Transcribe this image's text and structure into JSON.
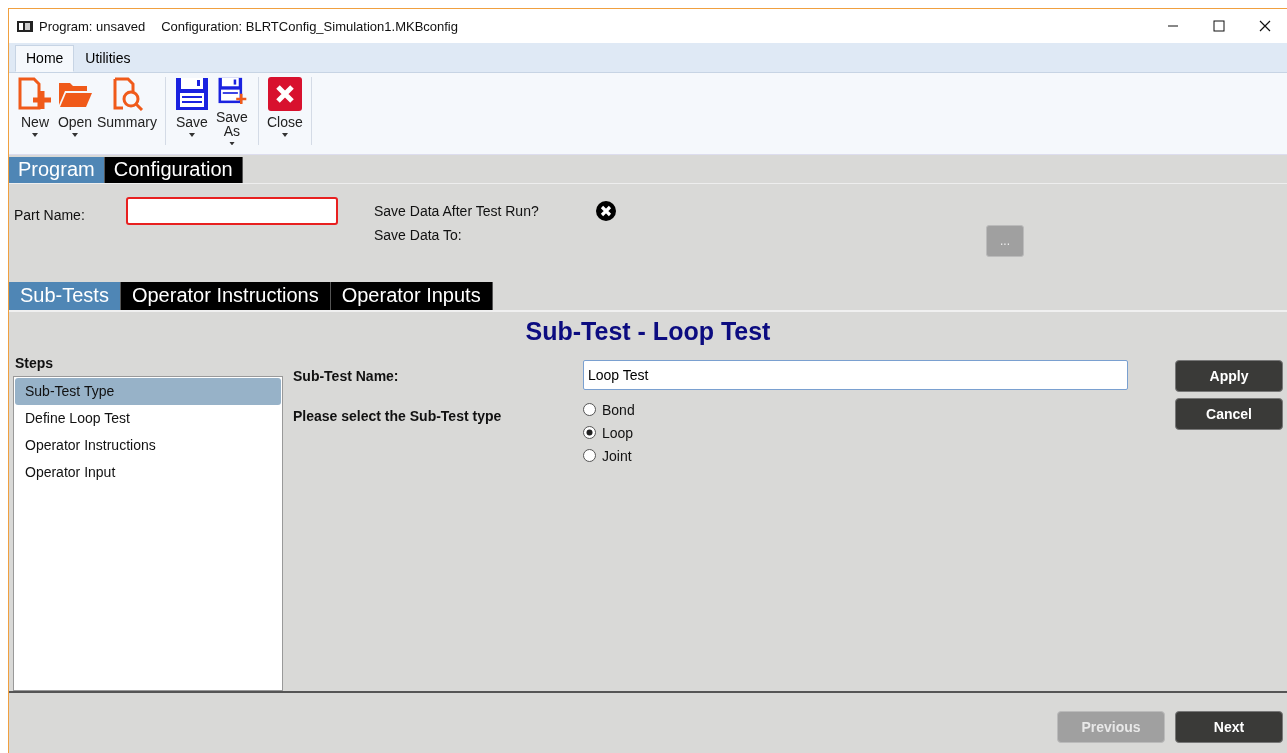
{
  "title_bar": {
    "program": "Program: unsaved",
    "configuration": "Configuration: BLRTConfig_Simulation1.MKBconfig"
  },
  "ribbon_tabs": [
    {
      "label": "Home",
      "selected": true
    },
    {
      "label": "Utilities",
      "selected": false
    }
  ],
  "ribbon_groups": [
    [
      {
        "label": "New",
        "kind": "new",
        "dropdown": true
      },
      {
        "label": "Open",
        "kind": "open",
        "dropdown": true
      },
      {
        "label": "Summary",
        "kind": "summary",
        "dropdown": false
      }
    ],
    [
      {
        "label": "Save",
        "kind": "save",
        "dropdown": true
      },
      {
        "label": "Save As",
        "kind": "save_as",
        "dropdown": true
      }
    ],
    [
      {
        "label": "Close",
        "kind": "close",
        "dropdown": true
      }
    ]
  ],
  "main_tabs": [
    {
      "label": "Program",
      "selected": true
    },
    {
      "label": "Configuration",
      "selected": false
    }
  ],
  "program_form": {
    "part_name_label": "Part Name:",
    "part_name_invalid": true,
    "save_after_label": "Save Data After Test Run?",
    "save_after": false,
    "save_to_label": "Save Data To:",
    "browse_button": {
      "label": "...",
      "disabled": true
    }
  },
  "sub_tabs": [
    {
      "label": "Sub-Tests",
      "selected": true
    },
    {
      "label": "Operator Instructions",
      "selected": false
    },
    {
      "label": "Operator Inputs",
      "selected": false
    }
  ],
  "heading": "Sub-Test - Loop Test",
  "steps": {
    "title": "Steps",
    "items": [
      {
        "label": "Sub-Test Type",
        "selected": true
      },
      {
        "label": "Define Loop Test",
        "selected": false
      },
      {
        "label": "Operator Instructions",
        "selected": false
      },
      {
        "label": "Operator Input",
        "selected": false
      }
    ]
  },
  "sub_test_form": {
    "name_label": "Sub-Test Name:",
    "name_value": "Loop Test",
    "type_label": "Please select the Sub-Test type",
    "type_options": [
      {
        "label": "Bond",
        "selected": false
      },
      {
        "label": "Loop",
        "selected": true
      },
      {
        "label": "Joint",
        "selected": false
      }
    ]
  },
  "side_buttons": [
    {
      "label": "Apply",
      "disabled": false
    },
    {
      "label": "Cancel",
      "disabled": false
    }
  ],
  "nav_buttons": [
    {
      "label": "Previous",
      "disabled": true
    },
    {
      "label": "Next",
      "disabled": false
    }
  ]
}
